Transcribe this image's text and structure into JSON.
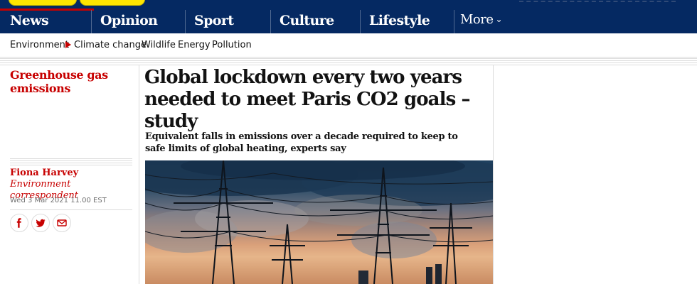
{
  "nav": {
    "items": [
      "News",
      "Opinion",
      "Sport",
      "Culture",
      "Lifestyle"
    ],
    "more_label": "More"
  },
  "subnav": {
    "items": [
      "Environment",
      "Climate change",
      "Wildlife",
      "Energy",
      "Pollution"
    ]
  },
  "article": {
    "kicker": "Greenhouse gas emissions",
    "headline": "Global lockdown every two years needed to meet Paris CO2 goals – study",
    "standfirst": "Equivalent falls in emissions over a decade required to keep to safe limits of global heating, experts say",
    "author": "Fiona Harvey",
    "author_role": "Environment correspondent",
    "date": "Wed 3 Mar 2021 11.00 EST"
  },
  "share": {
    "icons": [
      "facebook-icon",
      "twitter-icon",
      "email-icon"
    ]
  },
  "colors": {
    "brand_navy": "#052962",
    "accent_red": "#c70000",
    "pill_yellow": "#ffe500"
  }
}
